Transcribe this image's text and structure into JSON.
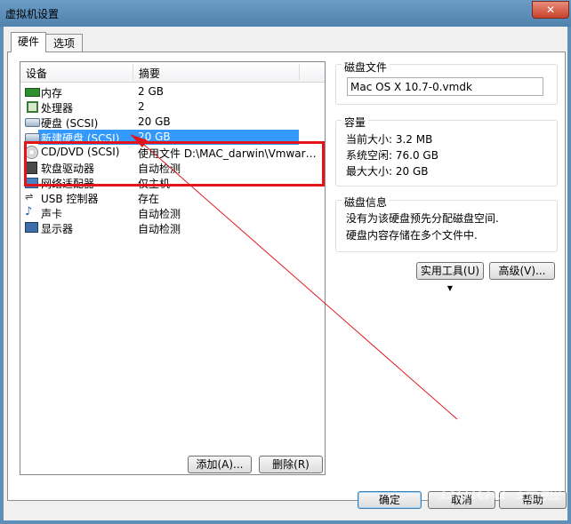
{
  "window": {
    "title": "虚拟机设置"
  },
  "tabs": [
    {
      "label": "硬件"
    },
    {
      "label": "选项"
    }
  ],
  "device_list": {
    "col_device": "设备",
    "col_summary": "摘要",
    "rows": [
      {
        "name": "内存",
        "summary": "2 GB",
        "icon": "memory-icon"
      },
      {
        "name": "处理器",
        "summary": "2",
        "icon": "processor-icon"
      },
      {
        "name": "硬盘 (SCSI)",
        "summary": "20 GB",
        "icon": "hard-disk-icon"
      },
      {
        "name": "新建硬盘 (SCSI)",
        "summary": "20 GB",
        "icon": "hard-disk-icon",
        "selected": true
      },
      {
        "name": "CD/DVD (SCSI)",
        "summary": "使用文件 D:\\MAC_darwin\\Vmwar…",
        "icon": "cd-dvd-icon"
      },
      {
        "name": "软盘驱动器",
        "summary": "自动检测",
        "icon": "floppy-icon"
      },
      {
        "name": "网络适配器",
        "summary": "仅主机",
        "icon": "network-adapter-icon"
      },
      {
        "name": "USB 控制器",
        "summary": "存在",
        "icon": "usb-icon"
      },
      {
        "name": "声卡",
        "summary": "自动检测",
        "icon": "sound-card-icon"
      },
      {
        "name": "显示器",
        "summary": "自动检测",
        "icon": "display-icon"
      }
    ]
  },
  "list_buttons": {
    "add": "添加(A)...",
    "remove": "删除(R)"
  },
  "disk_file": {
    "label": "磁盘文件",
    "value": "Mac OS X 10.7-0.vmdk"
  },
  "capacity": {
    "label": "容量",
    "current_size": "当前大小: 3.2 MB",
    "system_free": "系统空闲: 76.0 GB",
    "max_size": "最大大小: 20 GB"
  },
  "disk_info": {
    "label": "磁盘信息",
    "line1": "没有为该硬盘预先分配磁盘空间.",
    "line2": "硬盘内容存储在多个文件中."
  },
  "disk_buttons": {
    "utilities": "实用工具(U)",
    "advanced": "高级(V)..."
  },
  "footer_buttons": {
    "ok": "确定",
    "cancel": "取消",
    "help": "帮助"
  },
  "watermark": "Baidu 经验",
  "colors": {
    "selection": "#3399ff",
    "annotation": "#e2141a"
  }
}
